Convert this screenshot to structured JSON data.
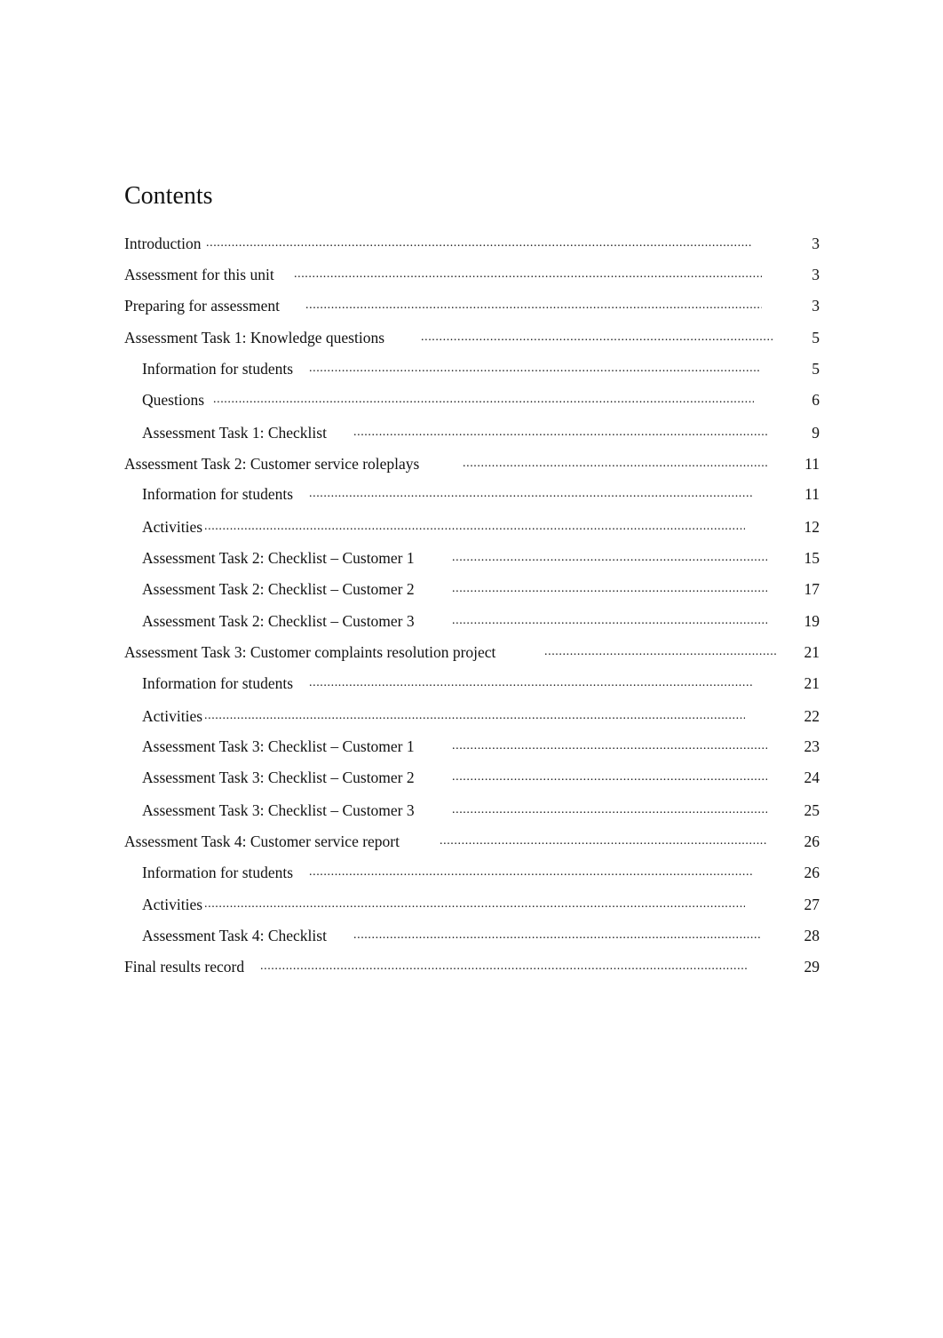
{
  "document": {
    "heading": "Contents",
    "toc": [
      {
        "label": "Introduction",
        "page": "3",
        "level": 1
      },
      {
        "label": "Assessment for this unit",
        "page": "3",
        "level": 1
      },
      {
        "label": "Preparing for assessment",
        "page": "3",
        "level": 1
      },
      {
        "label": "Assessment Task 1: Knowledge questions",
        "page": "5",
        "level": 1
      },
      {
        "label": "Information for students",
        "page": "5",
        "level": 2
      },
      {
        "label": "Questions",
        "page": "6",
        "level": 2
      },
      {
        "label": "Assessment Task 1: Checklist",
        "page": "9",
        "level": 2
      },
      {
        "label": "Assessment Task 2: Customer service roleplays",
        "page": "11",
        "level": 1
      },
      {
        "label": "Information for students",
        "page": "11",
        "level": 2
      },
      {
        "label": "Activities",
        "page": "12",
        "level": 2
      },
      {
        "label": "Assessment Task 2: Checklist – Customer 1",
        "page": "15",
        "level": 2
      },
      {
        "label": "Assessment Task 2: Checklist – Customer 2",
        "page": "17",
        "level": 2
      },
      {
        "label": "Assessment Task 2: Checklist – Customer 3",
        "page": "19",
        "level": 2
      },
      {
        "label": "Assessment Task 3: Customer complaints resolution project",
        "page": "21",
        "level": 1
      },
      {
        "label": "Information for students",
        "page": "21",
        "level": 2
      },
      {
        "label": "Activities",
        "page": "22",
        "level": 2
      },
      {
        "label": "Assessment Task 3: Checklist – Customer 1",
        "page": "23",
        "level": 2
      },
      {
        "label": "Assessment Task 3: Checklist – Customer 2",
        "page": "24",
        "level": 2
      },
      {
        "label": "Assessment Task 3: Checklist – Customer 3",
        "page": "25",
        "level": 2
      },
      {
        "label": "Assessment Task 4: Customer service report",
        "page": "26",
        "level": 1
      },
      {
        "label": "Information for students",
        "page": "26",
        "level": 2
      },
      {
        "label": "Activities",
        "page": "27",
        "level": 2
      },
      {
        "label": "Assessment Task 4: Checklist",
        "page": "28",
        "level": 2
      },
      {
        "label": "Final results record",
        "page": "29",
        "level": 1
      }
    ]
  }
}
